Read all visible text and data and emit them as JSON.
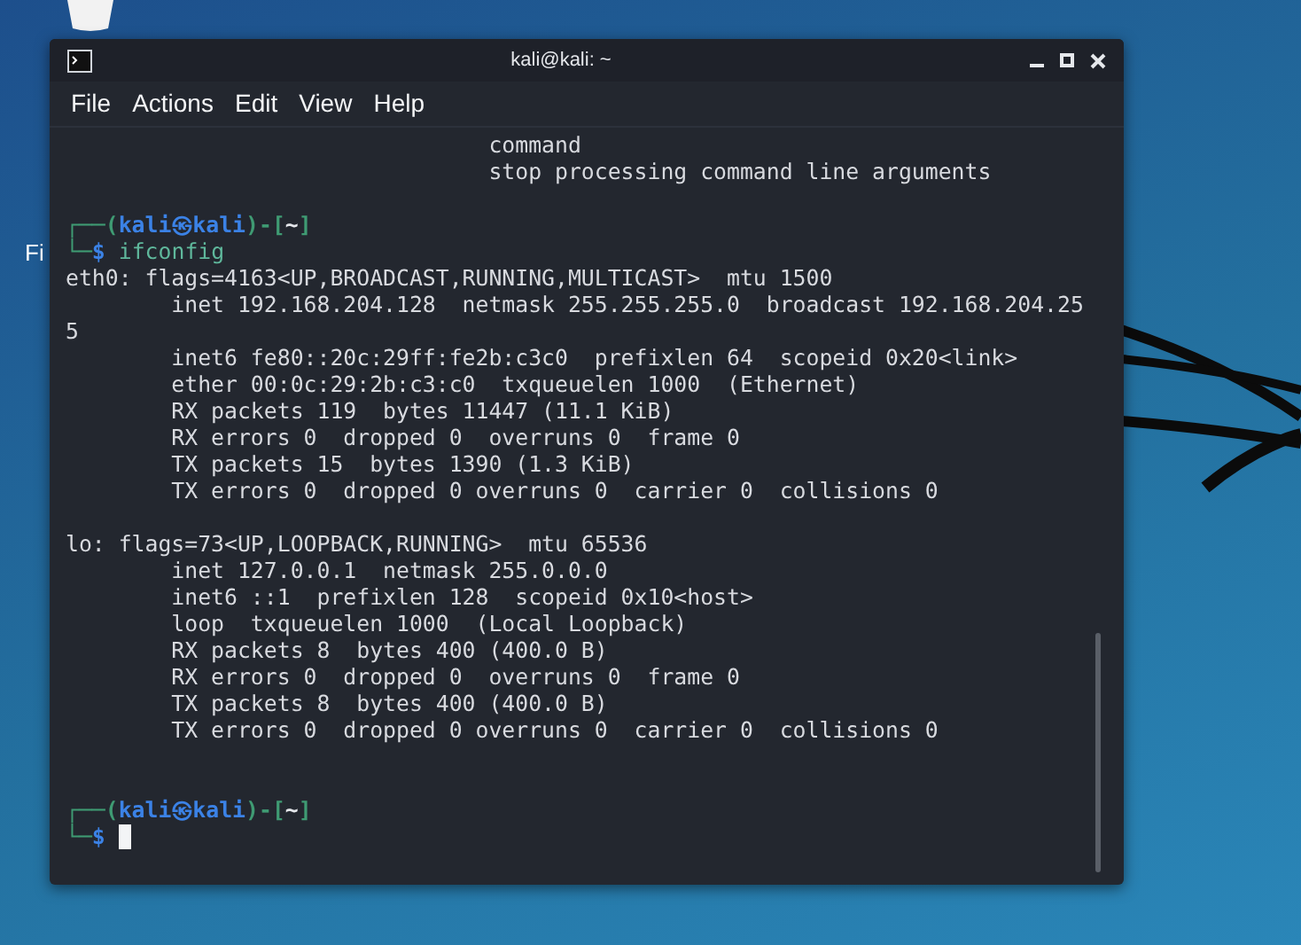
{
  "desktop": {
    "icon_labels": [
      "Fi"
    ]
  },
  "window": {
    "title": "kali@kali: ~",
    "menu": [
      "File",
      "Actions",
      "Edit",
      "View",
      "Help"
    ]
  },
  "terminal": {
    "lines": [
      {
        "kind": "output",
        "text": "                                command"
      },
      {
        "kind": "output",
        "text": "                                stop processing command line arguments"
      },
      {
        "kind": "blank"
      },
      {
        "kind": "prompt",
        "parts": [
          {
            "text": "┌──(",
            "color": "#3f9b73"
          },
          {
            "text": "kali㉿kali",
            "color": "#3b82e6"
          },
          {
            "text": ")-[",
            "color": "#3f9b73"
          },
          {
            "text": "~",
            "color": "#e5e7eb"
          },
          {
            "text": "]",
            "color": "#3f9b73"
          }
        ]
      },
      {
        "kind": "command",
        "parts": [
          {
            "text": "└─",
            "color": "#3f9b73"
          },
          {
            "text": "$",
            "color": "#3b82e6"
          }
        ],
        "command": "ifconfig"
      },
      {
        "kind": "output",
        "text": "eth0: flags=4163<UP,BROADCAST,RUNNING,MULTICAST>  mtu 1500"
      },
      {
        "kind": "output",
        "text": "        inet 192.168.204.128  netmask 255.255.255.0  broadcast 192.168.204.25"
      },
      {
        "kind": "output",
        "text": "5"
      },
      {
        "kind": "output",
        "text": "        inet6 fe80::20c:29ff:fe2b:c3c0  prefixlen 64  scopeid 0x20<link>"
      },
      {
        "kind": "output",
        "text": "        ether 00:0c:29:2b:c3:c0  txqueuelen 1000  (Ethernet)"
      },
      {
        "kind": "output",
        "text": "        RX packets 119  bytes 11447 (11.1 KiB)"
      },
      {
        "kind": "output",
        "text": "        RX errors 0  dropped 0  overruns 0  frame 0"
      },
      {
        "kind": "output",
        "text": "        TX packets 15  bytes 1390 (1.3 KiB)"
      },
      {
        "kind": "output",
        "text": "        TX errors 0  dropped 0 overruns 0  carrier 0  collisions 0"
      },
      {
        "kind": "blank"
      },
      {
        "kind": "output",
        "text": "lo: flags=73<UP,LOOPBACK,RUNNING>  mtu 65536"
      },
      {
        "kind": "output",
        "text": "        inet 127.0.0.1  netmask 255.0.0.0"
      },
      {
        "kind": "output",
        "text": "        inet6 ::1  prefixlen 128  scopeid 0x10<host>"
      },
      {
        "kind": "output",
        "text": "        loop  txqueuelen 1000  (Local Loopback)"
      },
      {
        "kind": "output",
        "text": "        RX packets 8  bytes 400 (400.0 B)"
      },
      {
        "kind": "output",
        "text": "        RX errors 0  dropped 0  overruns 0  frame 0"
      },
      {
        "kind": "output",
        "text": "        TX packets 8  bytes 400 (400.0 B)"
      },
      {
        "kind": "output",
        "text": "        TX errors 0  dropped 0 overruns 0  carrier 0  collisions 0"
      },
      {
        "kind": "blank"
      },
      {
        "kind": "blank"
      },
      {
        "kind": "prompt",
        "parts": [
          {
            "text": "┌──(",
            "color": "#3f9b73"
          },
          {
            "text": "kali㉿kali",
            "color": "#3b82e6"
          },
          {
            "text": ")-[",
            "color": "#3f9b73"
          },
          {
            "text": "~",
            "color": "#e5e7eb"
          },
          {
            "text": "]",
            "color": "#3f9b73"
          }
        ]
      },
      {
        "kind": "command",
        "parts": [
          {
            "text": "└─",
            "color": "#3f9b73"
          },
          {
            "text": "$",
            "color": "#3b82e6"
          }
        ],
        "cursor": true
      }
    ]
  }
}
